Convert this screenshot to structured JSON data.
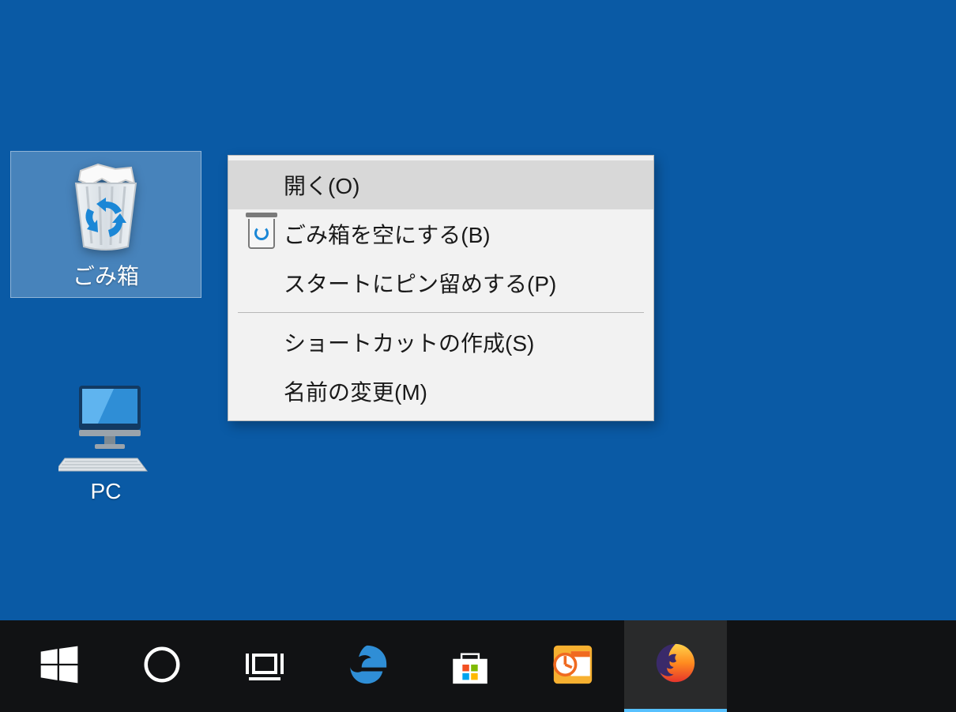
{
  "desktop": {
    "icons": [
      {
        "id": "recycle-bin",
        "label": "ごみ箱",
        "selected": true
      },
      {
        "id": "this-pc",
        "label": "PC",
        "selected": false
      }
    ]
  },
  "context_menu": {
    "target": "recycle-bin",
    "items": [
      {
        "label": "開く(O)",
        "icon": null,
        "highlighted": true
      },
      {
        "label": "ごみ箱を空にする(B)",
        "icon": "recycle-icon",
        "highlighted": false
      },
      {
        "label": "スタートにピン留めする(P)",
        "icon": null,
        "highlighted": false
      },
      {
        "separator": true
      },
      {
        "label": "ショートカットの作成(S)",
        "icon": null,
        "highlighted": false
      },
      {
        "label": "名前の変更(M)",
        "icon": null,
        "highlighted": false
      }
    ]
  },
  "taskbar": {
    "buttons": [
      {
        "id": "start",
        "name": "start-button",
        "icon": "windows-icon"
      },
      {
        "id": "cortana",
        "name": "cortana-button",
        "icon": "circle-icon"
      },
      {
        "id": "task-view",
        "name": "task-view-button",
        "icon": "taskview-icon"
      },
      {
        "id": "edge",
        "name": "edge-button",
        "icon": "edge-icon"
      },
      {
        "id": "store",
        "name": "store-button",
        "icon": "store-icon"
      },
      {
        "id": "outlook",
        "name": "outlook-button",
        "icon": "outlook-icon"
      },
      {
        "id": "firefox",
        "name": "firefox-button",
        "icon": "firefox-icon",
        "active": true
      }
    ]
  },
  "colors": {
    "desktop_bg": "#0a5aa5",
    "taskbar_bg": "#111214",
    "menu_bg": "#f2f2f2",
    "menu_hover": "#d8d8d8",
    "accent": "#57c1ff"
  }
}
